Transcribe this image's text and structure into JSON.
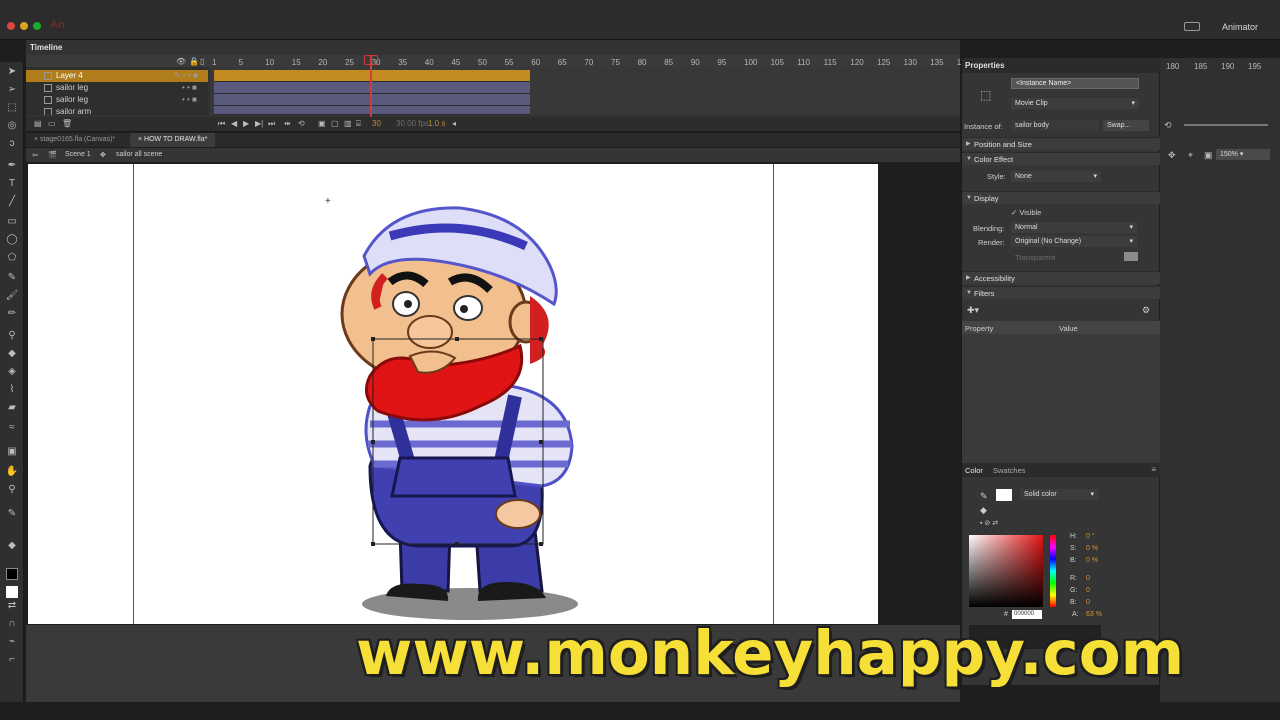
{
  "app": {
    "logo": "An",
    "workspace": "Animator"
  },
  "timeline": {
    "tab": "Timeline",
    "frame_ticks": [
      "1",
      "5",
      "10",
      "15",
      "20",
      "25",
      "30",
      "35",
      "40",
      "45",
      "50",
      "55",
      "60",
      "65",
      "70",
      "75",
      "80",
      "85",
      "90",
      "95",
      "100",
      "105",
      "110",
      "115",
      "120",
      "125",
      "130",
      "135",
      "1"
    ],
    "layers": [
      {
        "name": "Layer 4",
        "active": true
      },
      {
        "name": "sailor leg",
        "active": false
      },
      {
        "name": "sailor leg",
        "active": false
      },
      {
        "name": "sailor arm",
        "active": false
      }
    ],
    "current_frame": "30",
    "fps": "30.00 fps",
    "time": "1.0 s"
  },
  "documents": {
    "tabs": [
      "stage0165.fla (Canvas)*",
      "HOW TO DRAW.fla*"
    ],
    "active_index": 1
  },
  "breadcrumb": {
    "scene": "Scene 1",
    "symbol": "sailor all scene"
  },
  "right_ruler_ticks": [
    "180",
    "185",
    "190",
    "195"
  ],
  "zoom": "150%",
  "properties": {
    "title": "Properties",
    "instance_name_placeholder": "<Instance Name>",
    "symbol_type": "Movie Clip",
    "instance_of_label": "Instance of:",
    "instance_of": "sailor body",
    "swap_label": "Swap...",
    "sections": {
      "position_size": "Position and Size",
      "color_effect": "Color Effect",
      "display": "Display",
      "accessibility": "Accessibility",
      "filters": "Filters"
    },
    "style_label": "Style:",
    "style_value": "None",
    "visible_label": "Visible",
    "blending_label": "Blending:",
    "blending_value": "Normal",
    "render_label": "Render:",
    "render_value": "Original (No Change)",
    "transparent_label": "Transparent",
    "filter_columns": [
      "Property",
      "Value"
    ]
  },
  "color": {
    "tabs": [
      "Color",
      "Swatches"
    ],
    "fill_type": "Solid color",
    "h": "0 °",
    "s": "0 %",
    "b": "0 %",
    "r": "0",
    "g": "0",
    "b_val": "0",
    "hex": "000000",
    "alpha": "63 %",
    "labels": {
      "h": "H:",
      "s": "S:",
      "b": "B:",
      "r": "R:",
      "g": "G:",
      "bb": "B:",
      "a": "A:",
      "hash": "#"
    }
  },
  "watermark": "www.monkeyhappy.com",
  "colors": {
    "accent": "#b07d1c",
    "playhead": "#d23b3b",
    "watermark": "#f6df36"
  }
}
